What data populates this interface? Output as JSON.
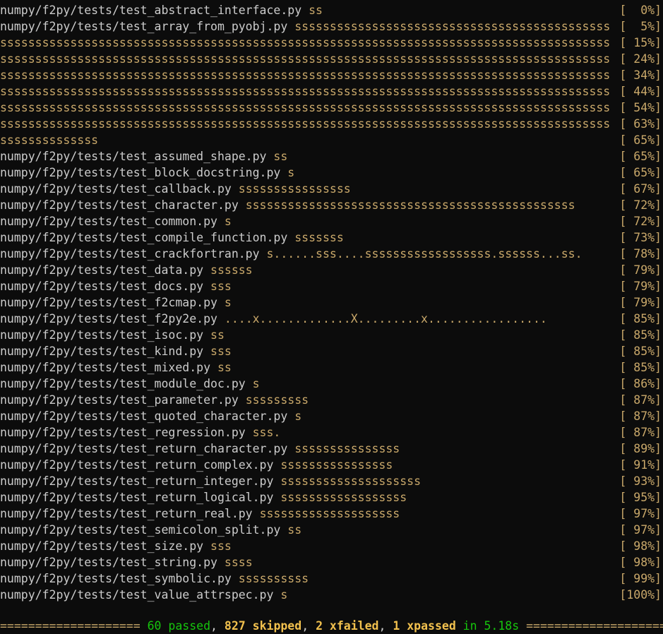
{
  "terminal": {
    "lines": [
      {
        "path": "numpy/f2py/tests/test_abstract_interface.py ",
        "result": "ss",
        "pct": "[  0%]"
      },
      {
        "path": "numpy/f2py/tests/test_array_from_pyobj.py ",
        "result": "sssssssssssssssssssssssssssssssssssssssssssss",
        "pct": "[  5%]"
      },
      {
        "path": "",
        "result": "sssssssssssssssssssssssssssssssssssssssssssssssssssssssssssssssssssssssssssssssssssssss",
        "pct": "[ 15%]"
      },
      {
        "path": "",
        "result": "sssssssssssssssssssssssssssssssssssssssssssssssssssssssssssssssssssssssssssssssssssssss",
        "pct": "[ 24%]"
      },
      {
        "path": "",
        "result": "sssssssssssssssssssssssssssssssssssssssssssssssssssssssssssssssssssssssssssssssssssssss",
        "pct": "[ 34%]"
      },
      {
        "path": "",
        "result": "sssssssssssssssssssssssssssssssssssssssssssssssssssssssssssssssssssssssssssssssssssssss",
        "pct": "[ 44%]"
      },
      {
        "path": "",
        "result": "sssssssssssssssssssssssssssssssssssssssssssssssssssssssssssssssssssssssssssssssssssssss",
        "pct": "[ 54%]"
      },
      {
        "path": "",
        "result": "sssssssssssssssssssssssssssssssssssssssssssssssssssssssssssssssssssssssssssssssssssssss",
        "pct": "[ 63%]"
      },
      {
        "path": "",
        "result": "ssssssssssssss",
        "pct": "[ 65%]"
      },
      {
        "path": "numpy/f2py/tests/test_assumed_shape.py ",
        "result": "ss",
        "pct": "[ 65%]"
      },
      {
        "path": "numpy/f2py/tests/test_block_docstring.py ",
        "result": "s",
        "pct": "[ 65%]"
      },
      {
        "path": "numpy/f2py/tests/test_callback.py ",
        "result": "ssssssssssssssss",
        "pct": "[ 67%]"
      },
      {
        "path": "numpy/f2py/tests/test_character.py ",
        "result": "sssssssssssssssssssssssssssssssssssssssssssssss",
        "pct": "[ 72%]"
      },
      {
        "path": "numpy/f2py/tests/test_common.py ",
        "result": "s",
        "pct": "[ 72%]"
      },
      {
        "path": "numpy/f2py/tests/test_compile_function.py ",
        "result": "sssssss",
        "pct": "[ 73%]"
      },
      {
        "path": "numpy/f2py/tests/test_crackfortran.py ",
        "result": "s......sss....ssssssssssssssssss.ssssss...ss.",
        "pct": "[ 78%]"
      },
      {
        "path": "numpy/f2py/tests/test_data.py ",
        "result": "ssssss",
        "pct": "[ 79%]"
      },
      {
        "path": "numpy/f2py/tests/test_docs.py ",
        "result": "sss",
        "pct": "[ 79%]"
      },
      {
        "path": "numpy/f2py/tests/test_f2cmap.py ",
        "result": "s",
        "pct": "[ 79%]"
      },
      {
        "path": "numpy/f2py/tests/test_f2py2e.py ",
        "result": "....x.............X.........x.................",
        "pct": "[ 85%]"
      },
      {
        "path": "numpy/f2py/tests/test_isoc.py ",
        "result": "ss",
        "pct": "[ 85%]"
      },
      {
        "path": "numpy/f2py/tests/test_kind.py ",
        "result": "sss",
        "pct": "[ 85%]"
      },
      {
        "path": "numpy/f2py/tests/test_mixed.py ",
        "result": "ss",
        "pct": "[ 85%]"
      },
      {
        "path": "numpy/f2py/tests/test_module_doc.py ",
        "result": "s",
        "pct": "[ 86%]"
      },
      {
        "path": "numpy/f2py/tests/test_parameter.py ",
        "result": "sssssssss",
        "pct": "[ 87%]"
      },
      {
        "path": "numpy/f2py/tests/test_quoted_character.py ",
        "result": "s",
        "pct": "[ 87%]"
      },
      {
        "path": "numpy/f2py/tests/test_regression.py ",
        "result": "sss.",
        "pct": "[ 87%]"
      },
      {
        "path": "numpy/f2py/tests/test_return_character.py ",
        "result": "sssssssssssssss",
        "pct": "[ 89%]"
      },
      {
        "path": "numpy/f2py/tests/test_return_complex.py ",
        "result": "ssssssssssssssss",
        "pct": "[ 91%]"
      },
      {
        "path": "numpy/f2py/tests/test_return_integer.py ",
        "result": "ssssssssssssssssssss",
        "pct": "[ 93%]"
      },
      {
        "path": "numpy/f2py/tests/test_return_logical.py ",
        "result": "ssssssssssssssssss",
        "pct": "[ 95%]"
      },
      {
        "path": "numpy/f2py/tests/test_return_real.py ",
        "result": "ssssssssssssssssssss",
        "pct": "[ 97%]"
      },
      {
        "path": "numpy/f2py/tests/test_semicolon_split.py ",
        "result": "ss",
        "pct": "[ 97%]"
      },
      {
        "path": "numpy/f2py/tests/test_size.py ",
        "result": "sss",
        "pct": "[ 98%]"
      },
      {
        "path": "numpy/f2py/tests/test_string.py ",
        "result": "ssss",
        "pct": "[ 98%]"
      },
      {
        "path": "numpy/f2py/tests/test_symbolic.py ",
        "result": "ssssssssss",
        "pct": "[ 99%]"
      },
      {
        "path": "numpy/f2py/tests/test_value_attrspec.py ",
        "result": "s",
        "pct": "[100%]"
      }
    ],
    "summary": {
      "left_rule": "==================== ",
      "passed": "60 passed",
      "sep1": ", ",
      "skipped": "827 skipped",
      "sep2": ", ",
      "xfailed": "2 xfailed",
      "sep3": ", ",
      "xpassed": "1 xpassed",
      "time": " in 5.18s ",
      "right_rule": "===================="
    }
  },
  "colors": {
    "background": "#0c0c0c",
    "path_text": "#cccccc",
    "result_text": "#c9a86a",
    "passed": "#16c60c",
    "highlight": "#f2c14e"
  }
}
